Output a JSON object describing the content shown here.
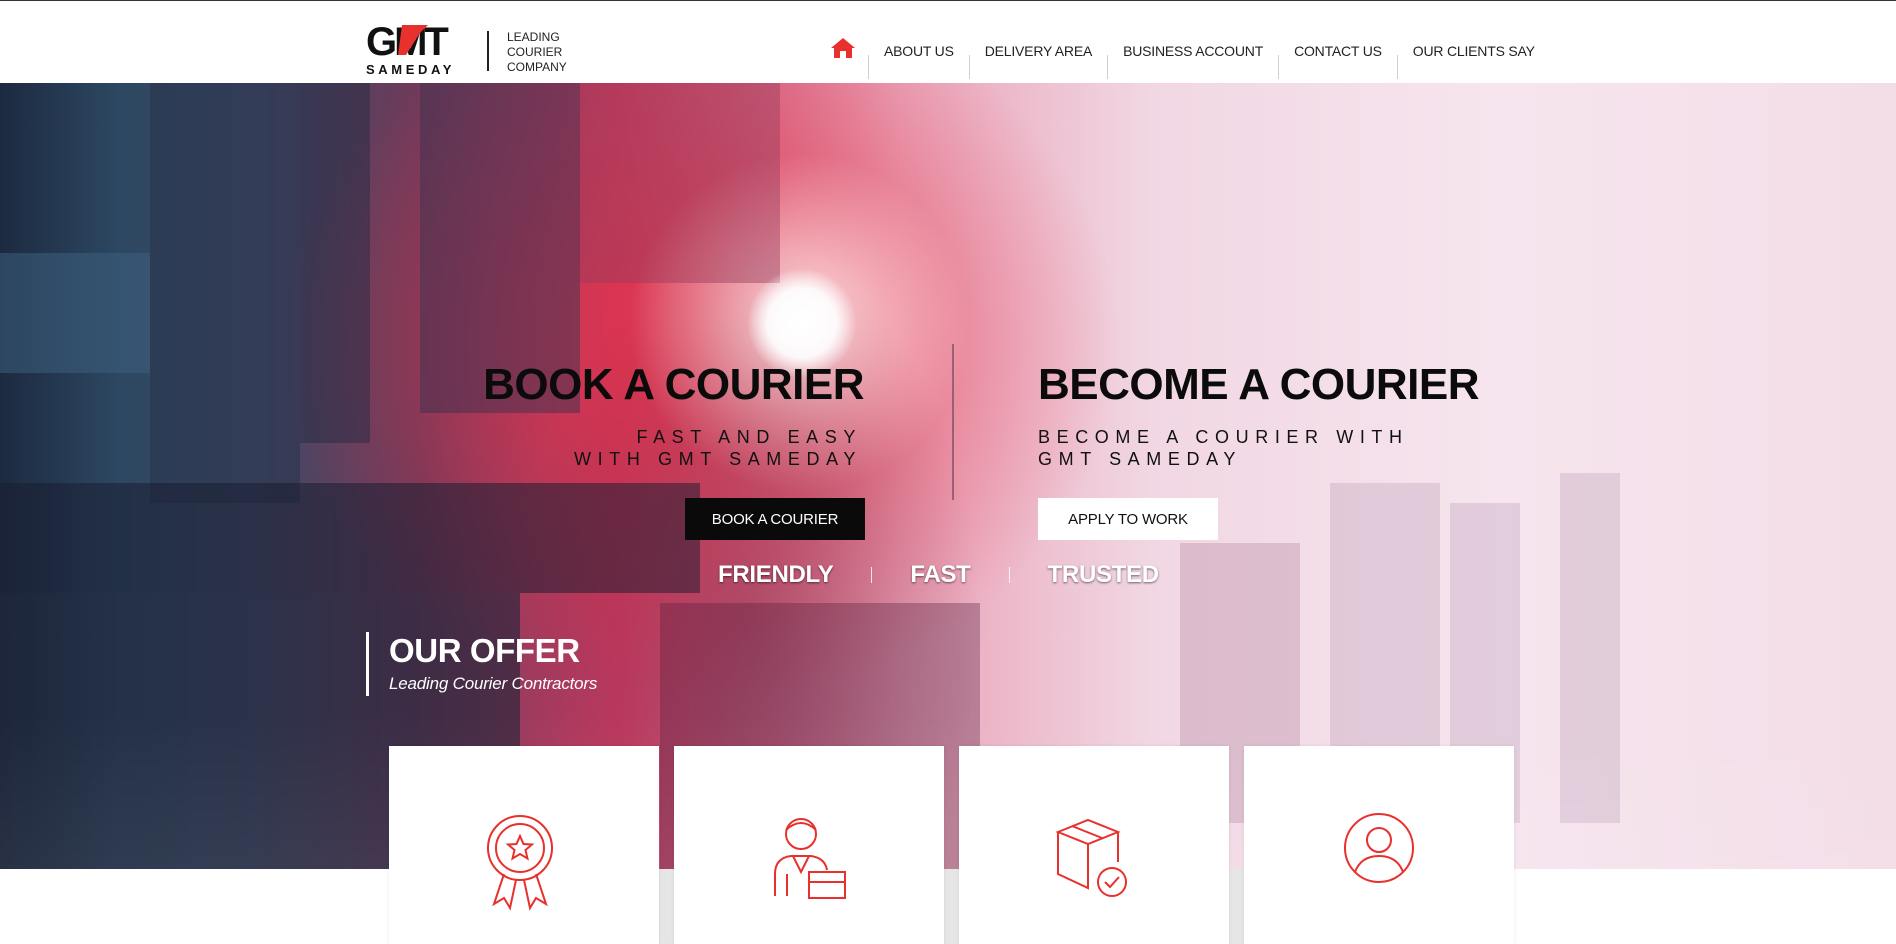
{
  "brand": {
    "logo_text": "GMT",
    "logo_sub": "SAMEDAY",
    "tagline": [
      "LEADING",
      "COURIER",
      "COMPANY"
    ],
    "accent_color": "#e8302d"
  },
  "nav": {
    "home_icon": "home-icon",
    "items": [
      {
        "label": "ABOUT US"
      },
      {
        "label": "DELIVERY AREA"
      },
      {
        "label": "BUSINESS ACCOUNT"
      },
      {
        "label": "CONTACT US"
      },
      {
        "label": "OUR CLIENTS SAY"
      }
    ]
  },
  "hero": {
    "book": {
      "title": "BOOK A COURIER",
      "sub_line1": "FAST AND EASY",
      "sub_line2": "WITH GMT SAMEDAY",
      "button": "BOOK A COURIER"
    },
    "become": {
      "title": "BECOME A COURIER",
      "sub_line1": "BECOME A COURIER WITH",
      "sub_line2": "GMT SAMEDAY",
      "button": "APPLY TO WORK"
    },
    "values": [
      "FRIENDLY",
      "FAST",
      "TRUSTED"
    ]
  },
  "offer": {
    "title": "OUR OFFER",
    "subtitle": "Leading Courier Contractors",
    "cards": [
      {
        "icon": "award-badge-icon"
      },
      {
        "icon": "courier-with-box-icon"
      },
      {
        "icon": "package-checked-icon"
      },
      {
        "icon": "user-circle-icon"
      }
    ]
  }
}
